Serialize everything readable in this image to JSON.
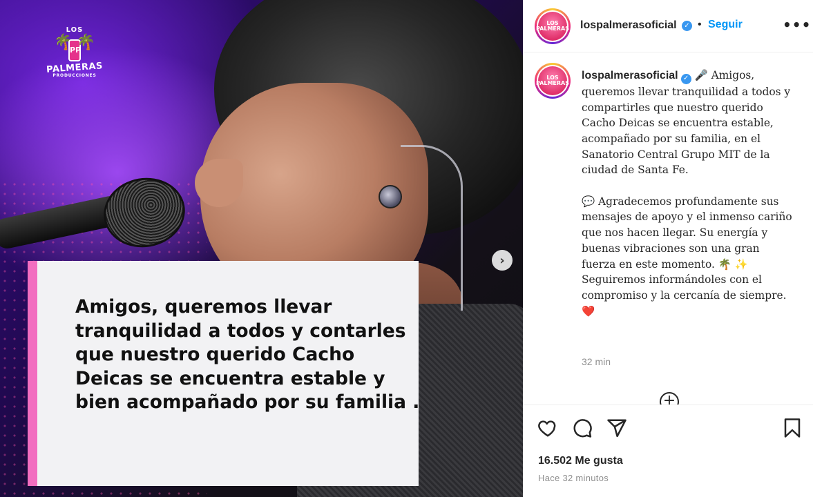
{
  "post_image": {
    "logo": {
      "los": "LOS",
      "name": "PALMERAS",
      "sub": "PRODUCCIONES",
      "mark": "PP"
    },
    "quote": "Amigos, queremos llevar tranquilidad a todos y contarles que nuestro querido Cacho Deicas se encuentra estable y bien acompañado por su familia .",
    "next_label": "›"
  },
  "header": {
    "username": "lospalmerasoficial",
    "verified_glyph": "✓",
    "separator": "•",
    "follow_label": "Seguir",
    "more_label": "•••",
    "avatar_text": "LOS PALMERAS"
  },
  "caption": {
    "username": "lospalmerasoficial",
    "verified_glyph": "✓",
    "paragraph1": "🎤 Amigos, queremos llevar tranquilidad a todos y compartirles que nuestro querido Cacho Deicas se encuentra estable, acompañado por su familia, en el Sanatorio Central Grupo MIT de la ciudad de Santa Fe.",
    "paragraph2": "💬 Agradecemos profundamente sus mensajes de apoyo y el inmenso cariño que nos hacen llegar. Su energía y buenas vibraciones son una gran fuerza en este momento. 🌴 ✨",
    "paragraph3": "Seguiremos informándoles con el compromiso y la cercanía de siempre. ❤️",
    "time": "32 min",
    "load_more_glyph": "+"
  },
  "actions": {
    "likes": "16.502 Me gusta",
    "time_ago": "Hace 32 minutos"
  },
  "colors": {
    "accent_blue": "#0095f6",
    "verified_blue": "#3897f0",
    "card_stripe_pink": "#f26ec0",
    "muted_text": "#8e8e8e"
  }
}
